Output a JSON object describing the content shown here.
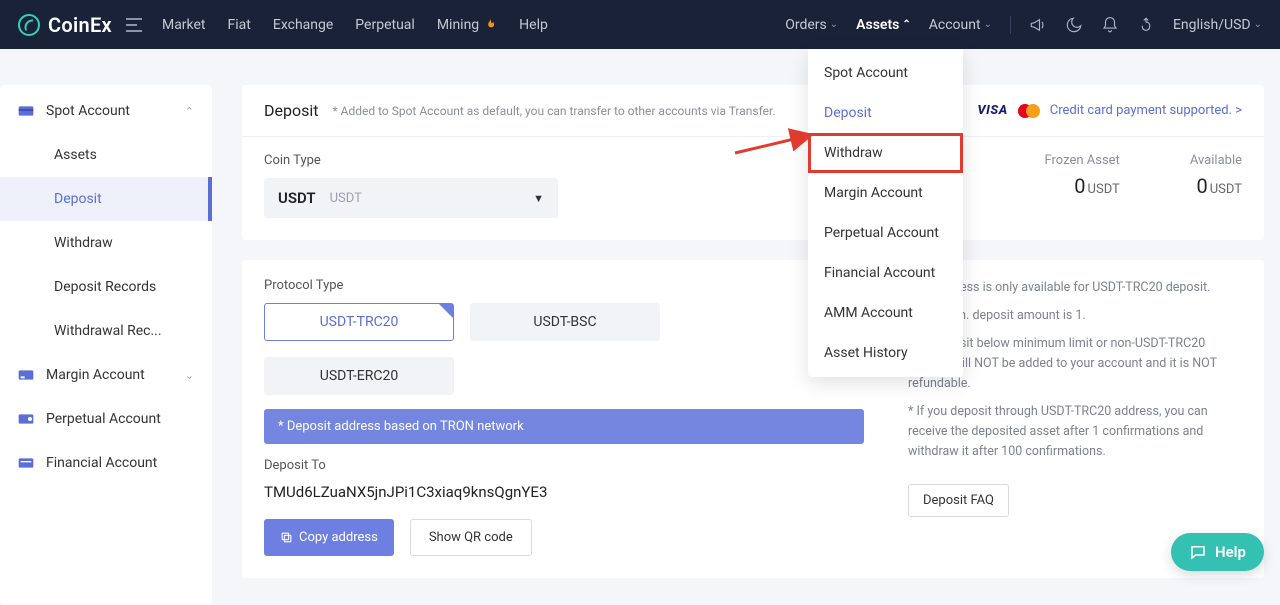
{
  "header": {
    "brand": "CoinEx",
    "nav_main": [
      "Market",
      "Fiat",
      "Exchange",
      "Perpetual",
      "Mining",
      "Help"
    ],
    "orders": "Orders",
    "assets": "Assets",
    "account": "Account",
    "locale": "English/USD"
  },
  "dropdown": {
    "items": [
      "Spot Account",
      "Deposit",
      "Withdraw",
      "Margin Account",
      "Perpetual Account",
      "Financial Account",
      "AMM Account",
      "Asset History"
    ]
  },
  "sidebar": {
    "spot": "Spot Account",
    "sub": [
      "Assets",
      "Deposit",
      "Withdraw",
      "Deposit Records",
      "Withdrawal Rec..."
    ],
    "margin": "Margin Account",
    "perpetual": "Perpetual Account",
    "financial": "Financial Account"
  },
  "deposit": {
    "title": "Deposit",
    "note": "* Added to Spot Account as default, you can transfer to other accounts via Transfer.",
    "cc_link": "Credit card payment supported. >",
    "visa": "VISA",
    "coin_type_label": "Coin Type",
    "coin_code": "USDT",
    "coin_name": "USDT",
    "balances": [
      {
        "label": "Frozen Asset",
        "value": "0",
        "unit": "USDT"
      },
      {
        "label": "Available",
        "value": "0",
        "unit": "USDT"
      }
    ],
    "protocol_label": "Protocol Type",
    "protocols": [
      {
        "label": "USDT-TRC20",
        "selected": true
      },
      {
        "label": "USDT-BSC",
        "selected": false
      },
      {
        "label": "USDT-ERC20",
        "selected": false
      }
    ],
    "network_note": "* Deposit address based on TRON network",
    "deposit_to_label": "Deposit To",
    "address": "TMUd6LZuaNX5jnJPi1C3xiaq9knsQgnYE3",
    "copy_btn": "Copy address",
    "qr_btn": "Show QR code",
    "side_info": [
      "This address is only available for USDT-TRC20 deposit.",
      "Single min. deposit amount is 1.",
      "Any deposit below minimum limit or non-USDT-TRC20 deposit will NOT be added to your account and it is NOT refundable.",
      "* If you deposit through USDT-TRC20 address, you can receive the deposited asset after 1 confirmations and withdraw it after 100 confirmations."
    ],
    "faq_btn": "Deposit FAQ"
  },
  "help_pill": "Help"
}
